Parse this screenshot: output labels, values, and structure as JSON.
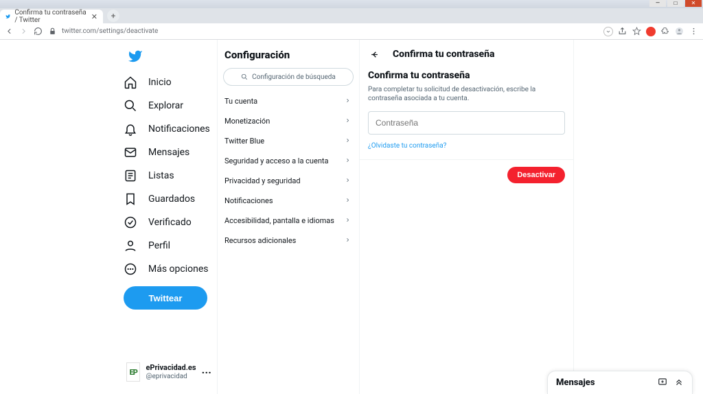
{
  "browser": {
    "tab_title": "Confirma tu contraseña / Twitter",
    "url": "twitter.com/settings/deactivate"
  },
  "nav": {
    "items": [
      {
        "label": "Inicio"
      },
      {
        "label": "Explorar"
      },
      {
        "label": "Notificaciones"
      },
      {
        "label": "Mensajes"
      },
      {
        "label": "Listas"
      },
      {
        "label": "Guardados"
      },
      {
        "label": "Verificado"
      },
      {
        "label": "Perfil"
      },
      {
        "label": "Más opciones"
      }
    ],
    "tweet_button": "Twittear"
  },
  "account": {
    "avatar_initials": "EP",
    "display_name": "ePrivacidad.es",
    "handle": "@eprivacidad"
  },
  "settings": {
    "title": "Configuración",
    "search_placeholder": "Configuración de búsqueda",
    "items": [
      {
        "label": "Tu cuenta"
      },
      {
        "label": "Monetización"
      },
      {
        "label": "Twitter Blue"
      },
      {
        "label": "Seguridad y acceso a la cuenta"
      },
      {
        "label": "Privacidad y seguridad"
      },
      {
        "label": "Notificaciones"
      },
      {
        "label": "Accesibilidad, pantalla e idiomas"
      },
      {
        "label": "Recursos adicionales"
      }
    ]
  },
  "detail": {
    "back_title": "Confirma tu contraseña",
    "subheading": "Confirma tu contraseña",
    "description": "Para completar tu solicitud de desactivación, escribe la contraseña asociada a tu cuenta.",
    "password_placeholder": "Contraseña",
    "forgot_link": "¿Olvidaste tu contraseña?",
    "deactivate_button": "Desactivar"
  },
  "messages_dock": {
    "title": "Mensajes"
  }
}
